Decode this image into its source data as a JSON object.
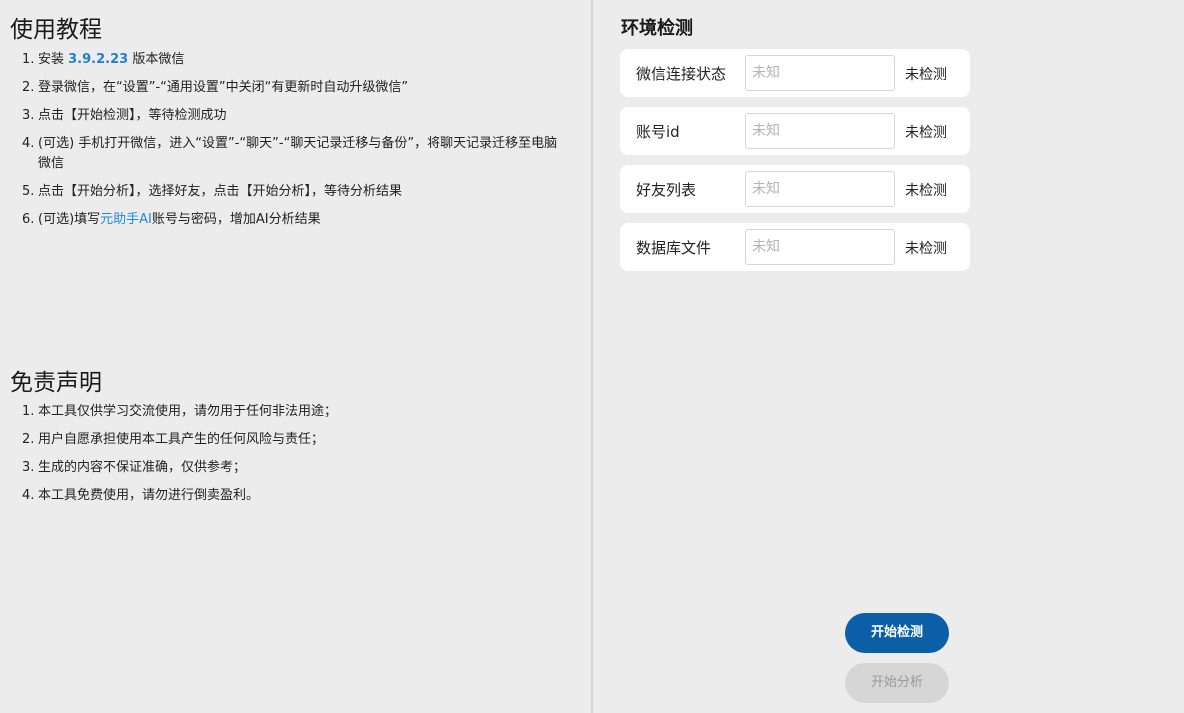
{
  "tutorial": {
    "title": "使用教程",
    "steps": [
      {
        "num": "1.",
        "pre": "安装 ",
        "highlight": "3.9.2.23",
        "post": " 版本微信"
      },
      {
        "num": "2.",
        "text": "登录微信，在“设置”-“通用设置”中关闭“有更新时自动升级微信”"
      },
      {
        "num": "3.",
        "text": "点击【开始检测】，等待检测成功"
      },
      {
        "num": "4.",
        "text": "(可选) 手机打开微信，进入“设置”-“聊天”-“聊天记录迁移与备份”，将聊天记录迁移至电脑微信"
      },
      {
        "num": "5.",
        "text": "点击【开始分析】，选择好友，点击【开始分析】，等待分析结果"
      },
      {
        "num": "6.",
        "pre": "(可选)填写",
        "highlight": "元助手AI",
        "post": "账号与密码，增加AI分析结果"
      }
    ]
  },
  "disclaimer": {
    "title": "免责声明",
    "items": [
      {
        "num": "1.",
        "text": "本工具仅供学习交流使用，请勿用于任何非法用途；"
      },
      {
        "num": "2.",
        "text": "用户自愿承担使用本工具产生的任何风险与责任；"
      },
      {
        "num": "3.",
        "text": "生成的内容不保证准确，仅供参考；"
      },
      {
        "num": "4.",
        "text": "本工具免费使用，请勿进行倒卖盈利。"
      }
    ]
  },
  "env": {
    "title": "环境检测",
    "rows": [
      {
        "label": "微信连接状态",
        "placeholder": "未知",
        "status": "未检测"
      },
      {
        "label": "账号id",
        "placeholder": "未知",
        "status": "未检测"
      },
      {
        "label": "好友列表",
        "placeholder": "未知",
        "status": "未检测"
      },
      {
        "label": "数据库文件",
        "placeholder": "未知",
        "status": "未检测"
      }
    ]
  },
  "actions": {
    "start_check": "开始检测",
    "start_analysis": "开始分析"
  },
  "colors": {
    "accent": "#1f8ae0",
    "primary_button": "#0a5fa6",
    "disabled_button": "#d6d6d6",
    "background": "#ececec"
  }
}
